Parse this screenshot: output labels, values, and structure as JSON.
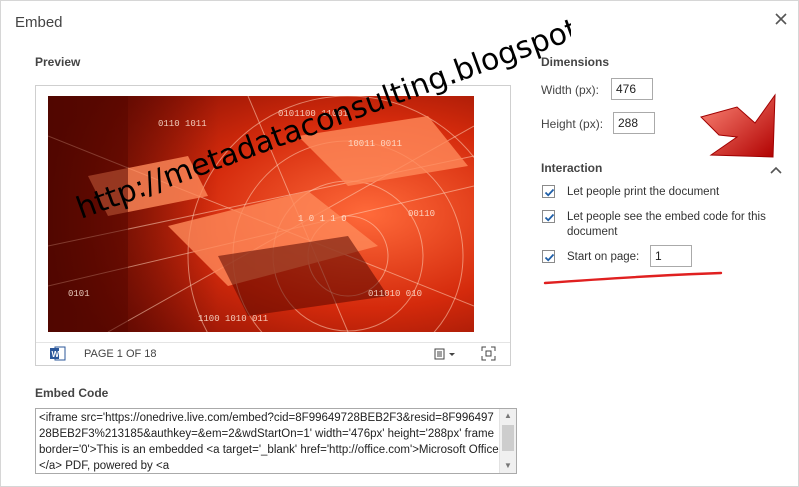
{
  "dialog": {
    "title": "Embed"
  },
  "preview": {
    "heading": "Preview",
    "page_indicator": "PAGE 1 OF 18"
  },
  "embed_code": {
    "heading": "Embed Code",
    "value": "<iframe src='https://onedrive.live.com/embed?cid=8F99649728BEB2F3&resid=8F99649728BEB2F3%213185&authkey=&em=2&wdStartOn=1' width='476px' height='288px' frameborder='0'>This is an embedded <a target='_blank' href='http://office.com'>Microsoft Office</a> PDF, powered by <a"
  },
  "dimensions": {
    "heading": "Dimensions",
    "width_label": "Width (px):",
    "width_value": "476",
    "height_label": "Height (px):",
    "height_value": "288"
  },
  "interaction": {
    "heading": "Interaction",
    "print_label": "Let people print the document",
    "print_checked": true,
    "embed_line1": "Let people see the embed code for this",
    "embed_line2": "document",
    "embed_checked": true,
    "start_label": "Start on page:",
    "start_checked": true,
    "start_value": "1"
  },
  "annotations": {
    "watermark_text": "http://metadataconsulting.blogspot.ca/",
    "watermark_color": "#000000",
    "marker_color": "#e02020"
  },
  "icons": {
    "word": "word-doc-icon",
    "view": "reading-view-icon",
    "fit": "fullscreen-icon",
    "close": "close-icon",
    "collapse": "chevron-up-icon"
  }
}
